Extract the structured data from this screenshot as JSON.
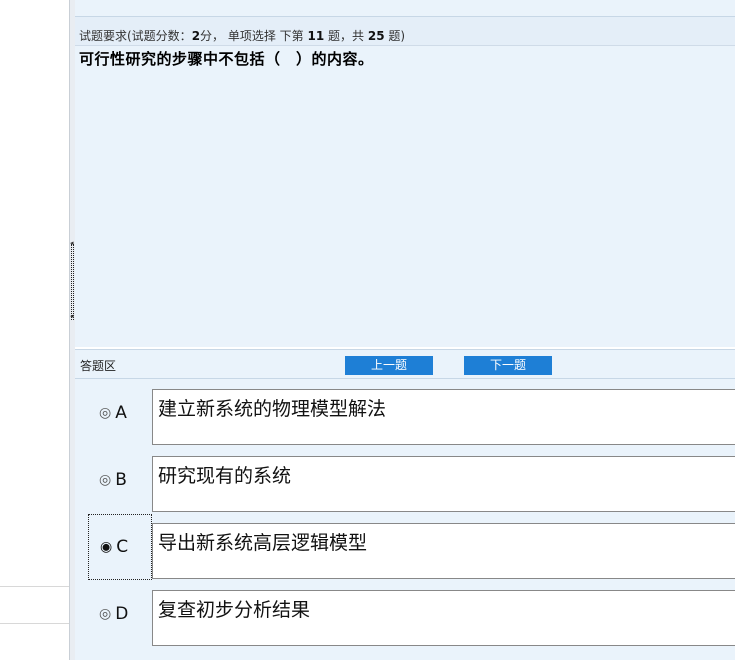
{
  "question": {
    "requirement_prefix": "试题要求(试题分数：",
    "score": "2",
    "requirement_mid": "分， 单项选择 下第 ",
    "question_no": "11",
    "requirement_mid2": " 题，共 ",
    "total": "25",
    "requirement_suffix": " 题)",
    "text": "可行性研究的步骤中不包括（　）的内容。"
  },
  "answer_area": {
    "label": "答题区",
    "prev_label": "上一题",
    "next_label": "下一题"
  },
  "options": [
    {
      "letter": "A",
      "text": "建立新系统的物理模型解法",
      "selected": false
    },
    {
      "letter": "B",
      "text": "研究现有的系统",
      "selected": false
    },
    {
      "letter": "C",
      "text": "导出新系统高层逻辑模型",
      "selected": true
    },
    {
      "letter": "D",
      "text": "复查初步分析结果",
      "selected": false
    }
  ],
  "icons": {
    "radio_unchecked": "◎",
    "radio_checked": "◉",
    "splitter_arrow_up": "◂",
    "splitter_arrow_down": "◂"
  },
  "colors": {
    "panel_bg": "#eaf3fb",
    "button_bg": "#1e7fd6",
    "button_text": "#ffffff"
  }
}
